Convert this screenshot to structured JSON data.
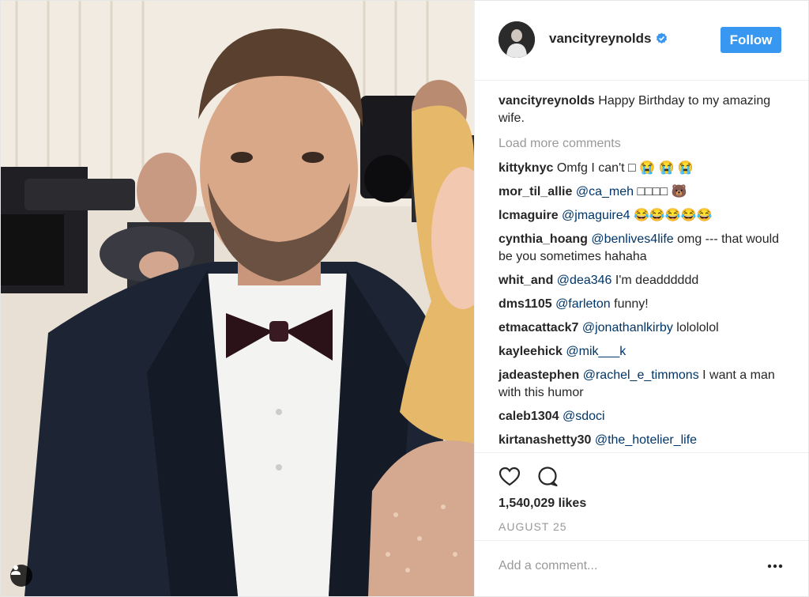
{
  "header": {
    "username": "vancityreynolds",
    "follow_label": "Follow"
  },
  "caption": {
    "username": "vancityreynolds",
    "text": "Happy Birthday to my amazing wife."
  },
  "load_more_label": "Load more comments",
  "comments": [
    {
      "user": "kittyknyc",
      "mention": "",
      "text": "Omfg I can't □ 😭 😭 😭"
    },
    {
      "user": "mor_til_allie",
      "mention": "@ca_meh",
      "text": "□□□□ 🐻"
    },
    {
      "user": "lcmaguire",
      "mention": "@jmaguire4",
      "text": "😂😂😂😂😂"
    },
    {
      "user": "cynthia_hoang",
      "mention": "@benlives4life",
      "text": "omg --- that would be you sometimes hahaha"
    },
    {
      "user": "whit_and",
      "mention": "@dea346",
      "text": "I'm deadddddd"
    },
    {
      "user": "dms1105",
      "mention": "@farleton",
      "text": "funny!"
    },
    {
      "user": "etmacattack7",
      "mention": "@jonathanlkirby",
      "text": "lolololol"
    },
    {
      "user": "kayleehick",
      "mention": "@mik___k",
      "text": ""
    },
    {
      "user": "jadeastephen",
      "mention": "@rachel_e_timmons",
      "text": "I want a man with this humor"
    },
    {
      "user": "caleb1304",
      "mention": "@sdoci",
      "text": ""
    },
    {
      "user": "kirtanashetty30",
      "mention": "@the_hotelier_life",
      "text": ""
    }
  ],
  "likes": "1,540,029 likes",
  "date": "AUGUST 25",
  "add_comment_placeholder": "Add a comment...",
  "icons": {
    "like": "heart-icon",
    "comment": "comment-icon",
    "verified": "verified-badge-icon",
    "more": "more-options-icon",
    "tag": "user-tag-icon"
  },
  "colors": {
    "follow_button": "#3897f0",
    "mention": "#003569",
    "muted": "#999999",
    "verified": "#3897f0"
  }
}
